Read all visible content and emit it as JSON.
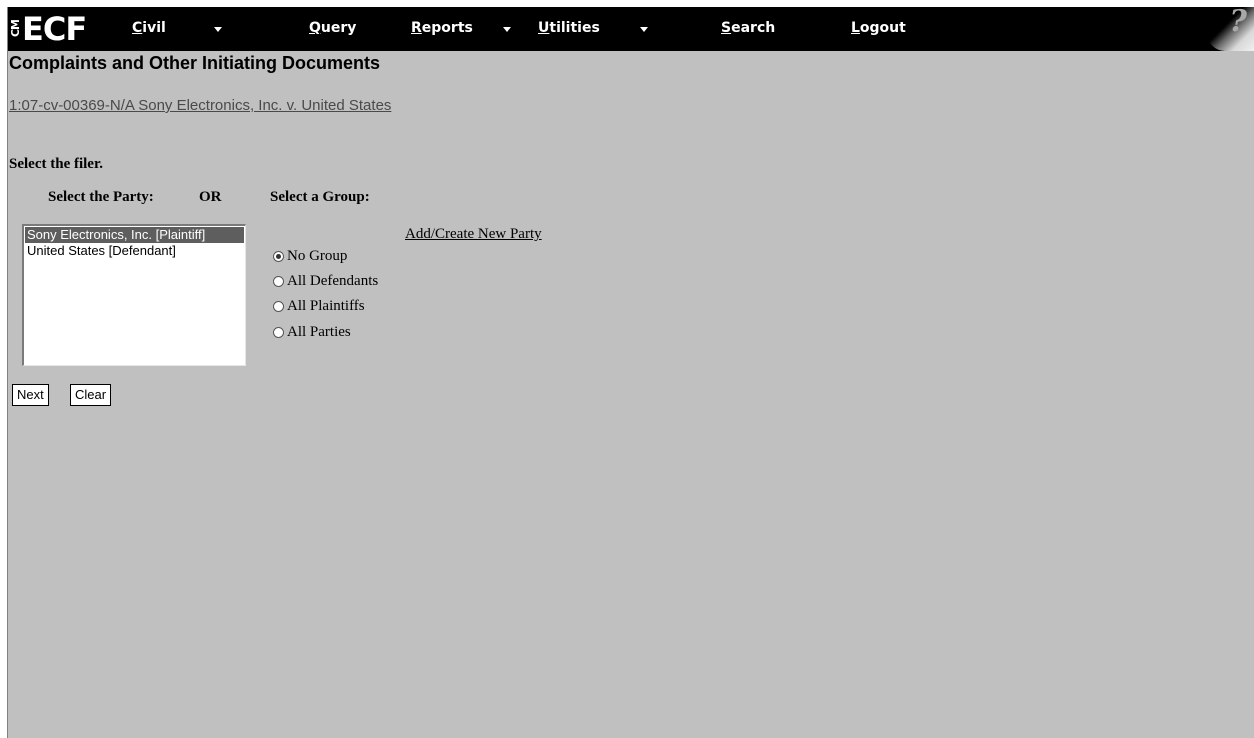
{
  "menubar": {
    "logo_cm": "CM",
    "logo_ecf": "ECF",
    "items": [
      {
        "first": "C",
        "rest": "ivil",
        "has_dropdown": true
      },
      {
        "first": "Q",
        "rest": "uery",
        "has_dropdown": false
      },
      {
        "first": "R",
        "rest": "eports",
        "has_dropdown": true
      },
      {
        "first": "U",
        "rest": "tilities",
        "has_dropdown": true
      },
      {
        "first": "S",
        "rest": "earch",
        "has_dropdown": false
      },
      {
        "first": "L",
        "rest": "ogout",
        "has_dropdown": false
      }
    ],
    "help_glyph": "?"
  },
  "page": {
    "heading": "Complaints and Other Initiating Documents",
    "case_link": "1:07-cv-00369-N/A Sony Electronics, Inc. v. United States"
  },
  "filer": {
    "prompt": "Select the filer.",
    "party_label": "Select the Party:",
    "or_label": "OR",
    "group_label": "Select a Group:",
    "parties": [
      {
        "label": "Sony Electronics, Inc. [Plaintiff]",
        "selected": true
      },
      {
        "label": "United States [Defendant]",
        "selected": false
      }
    ],
    "add_party_link": "Add/Create New Party",
    "groups": [
      {
        "label": "No Group",
        "checked": true
      },
      {
        "label": "All Defendants",
        "checked": false
      },
      {
        "label": "All Plaintiffs",
        "checked": false
      },
      {
        "label": "All Parties",
        "checked": false
      }
    ]
  },
  "buttons": {
    "next": "Next",
    "clear": "Clear"
  }
}
